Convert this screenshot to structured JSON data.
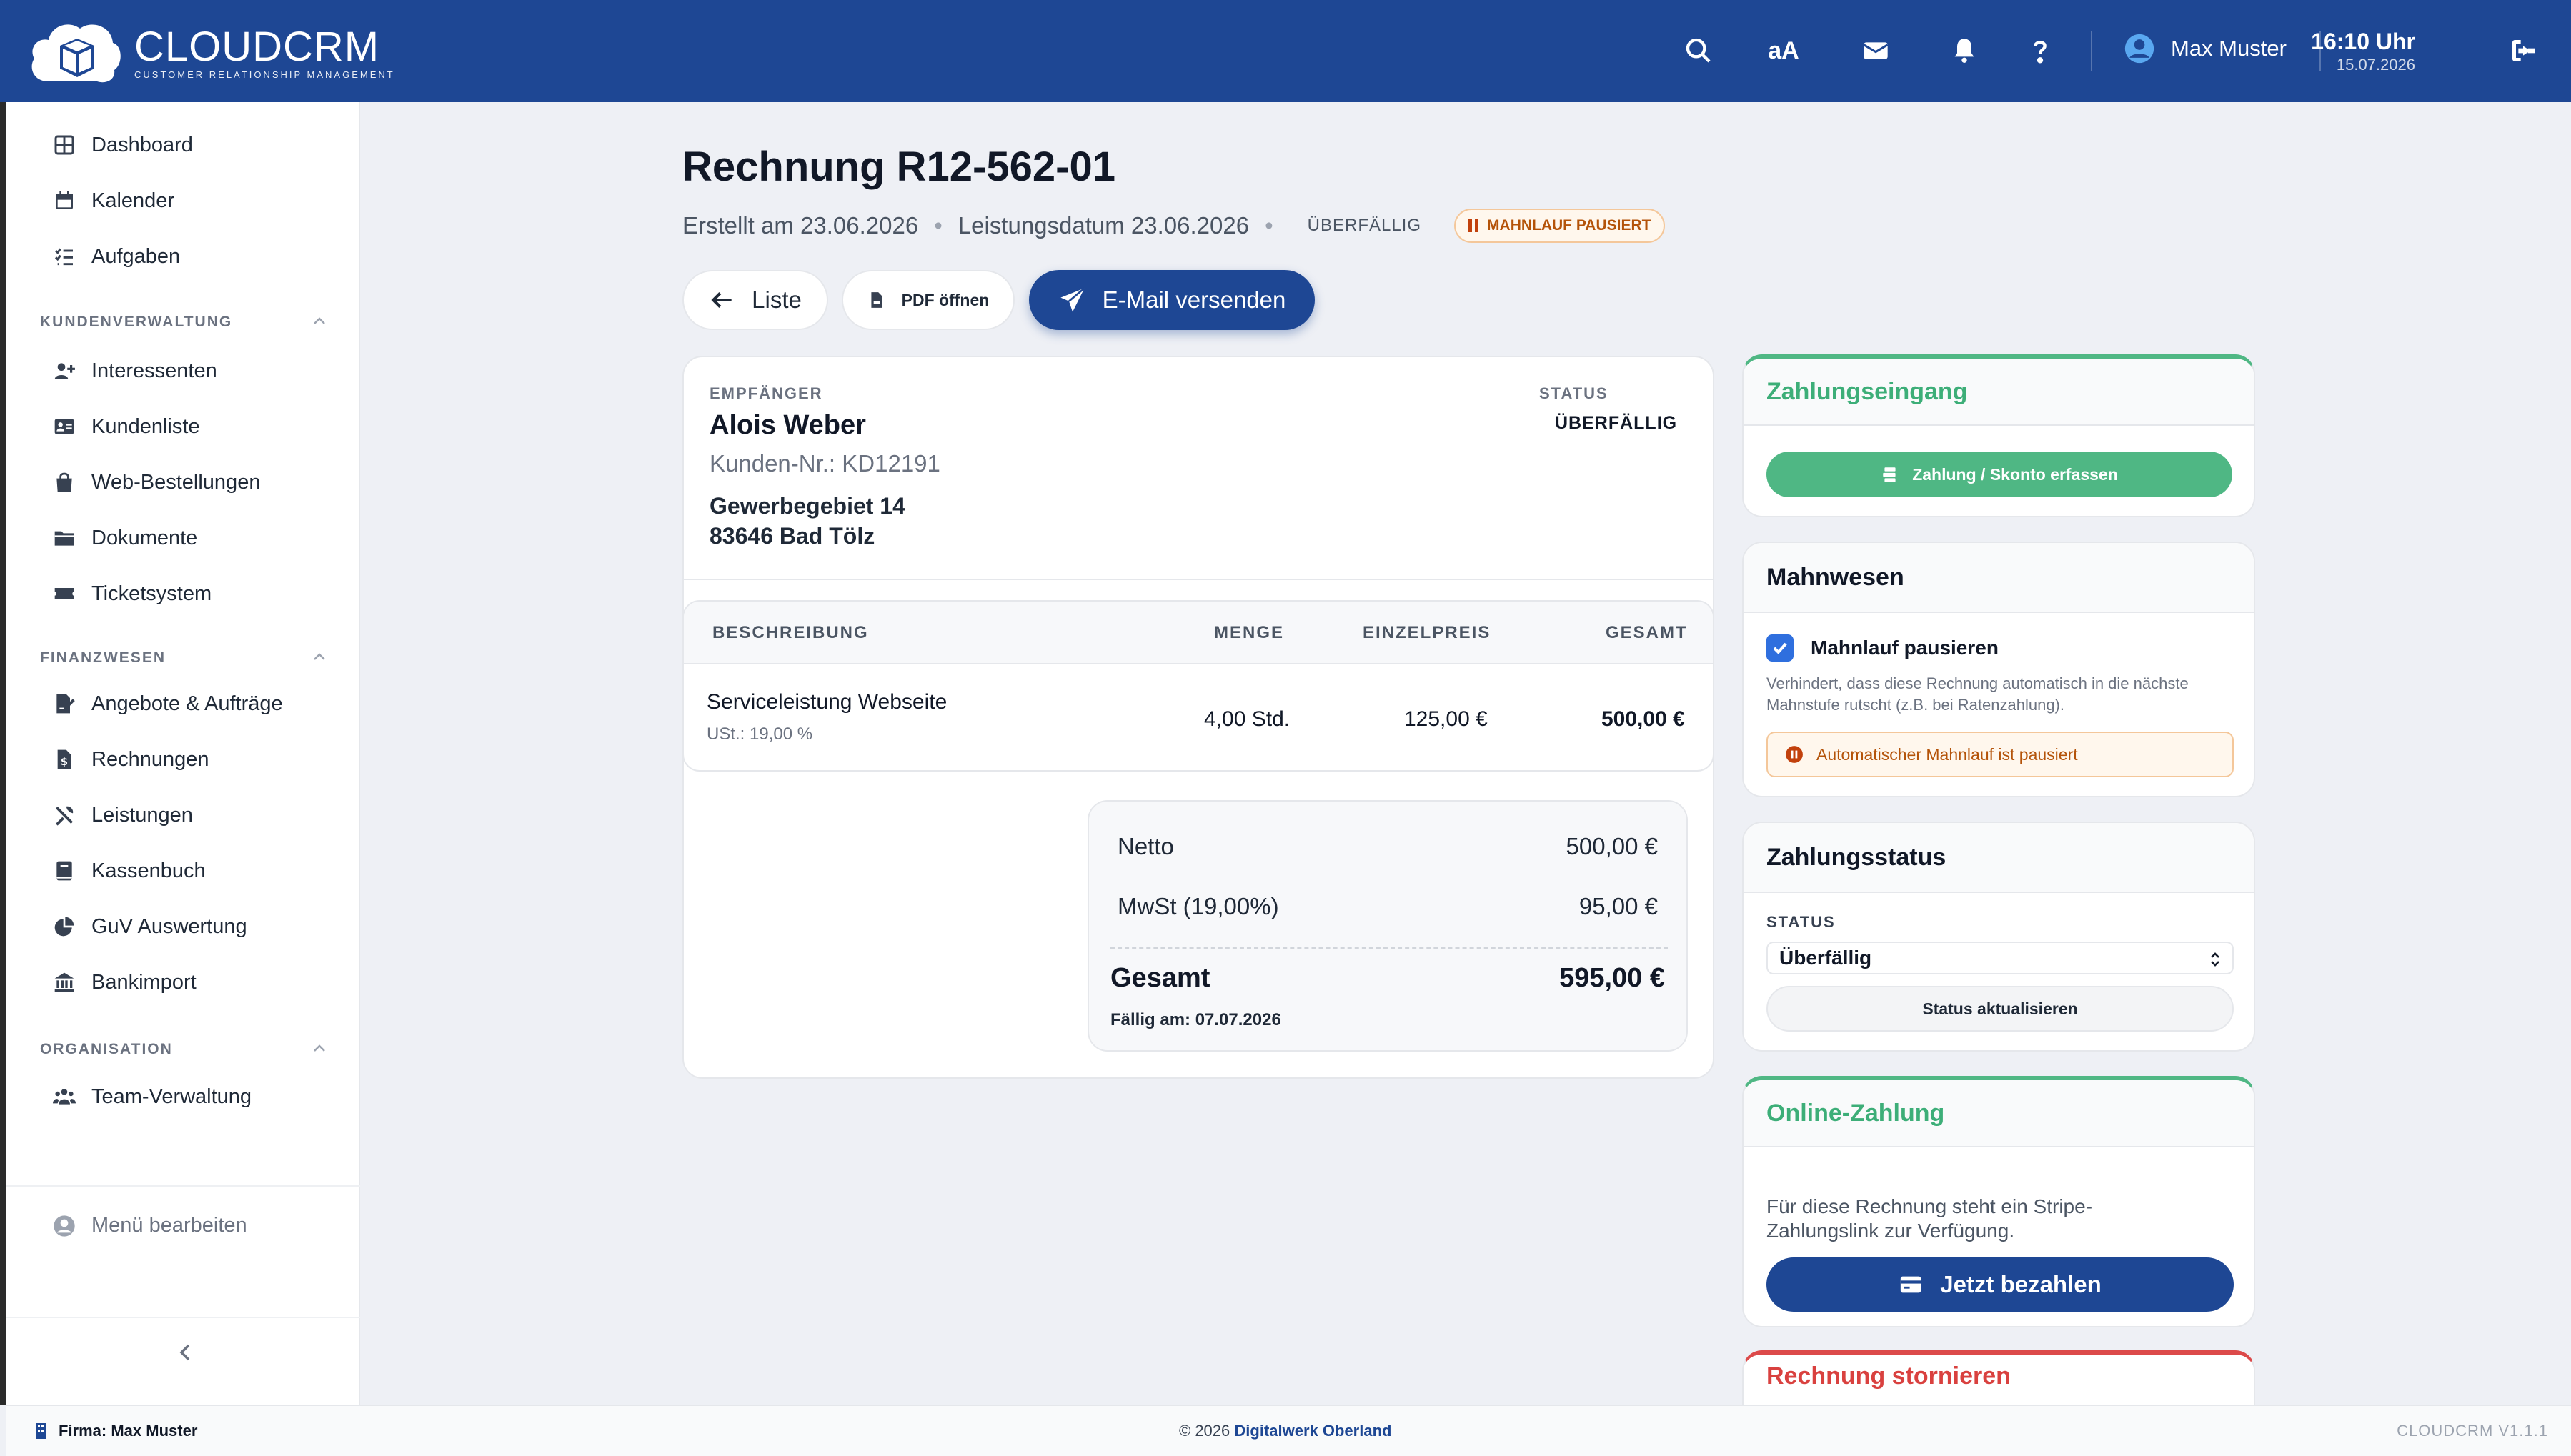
{
  "app": {
    "logo_title": "CLOUDCRM",
    "logo_subtitle": "CUSTOMER RELATIONSHIP MANAGEMENT"
  },
  "header": {
    "font_size_label": "aA",
    "user_name": "Max Muster",
    "time": "16:10 Uhr",
    "date": "15.07.2026",
    "icons": [
      "search-icon",
      "font-size-icon",
      "mail-icon",
      "bell-icon",
      "help-icon",
      "user-circle-icon",
      "logout-icon"
    ]
  },
  "sidebar": {
    "top_items": [
      {
        "label": "Dashboard",
        "icon": "dashboard-icon"
      },
      {
        "label": "Kalender",
        "icon": "calendar-icon"
      },
      {
        "label": "Aufgaben",
        "icon": "tasks-icon"
      }
    ],
    "sections": [
      {
        "title": "KUNDENVERWALTUNG",
        "items": [
          {
            "label": "Interessenten",
            "icon": "user-plus-icon"
          },
          {
            "label": "Kundenliste",
            "icon": "address-card-icon"
          },
          {
            "label": "Web-Bestellungen",
            "icon": "shopping-bag-icon"
          },
          {
            "label": "Dokumente",
            "icon": "folder-icon"
          },
          {
            "label": "Ticketsystem",
            "icon": "ticket-icon"
          }
        ]
      },
      {
        "title": "FINANZWESEN",
        "items": [
          {
            "label": "Angebote & Aufträge",
            "icon": "file-signature-icon"
          },
          {
            "label": "Rechnungen",
            "icon": "invoice-icon"
          },
          {
            "label": "Leistungen",
            "icon": "tools-icon"
          },
          {
            "label": "Kassenbuch",
            "icon": "book-icon"
          },
          {
            "label": "GuV Auswertung",
            "icon": "pie-chart-icon"
          },
          {
            "label": "Bankimport",
            "icon": "bank-icon"
          }
        ]
      },
      {
        "title": "ORGANISATION",
        "items": [
          {
            "label": "Team-Verwaltung",
            "icon": "users-icon"
          }
        ]
      }
    ],
    "menu_edit": "Menü bearbeiten"
  },
  "invoice": {
    "title": "Rechnung R12-562-01",
    "created": "Erstellt am 23.06.2026",
    "service_date": "Leistungsdatum 23.06.2026",
    "status_text": "ÜBERFÄLLIG",
    "dunning_badge": "MAHNLAUF PAUSIERT",
    "buttons": {
      "list": "Liste",
      "pdf": "PDF öffnen",
      "email": "E-Mail versenden"
    },
    "recipient": {
      "label": "EMPFÄNGER",
      "name": "Alois Weber",
      "customer_no": "Kunden-Nr.: KD12191",
      "street": "Gewerbegebiet 14",
      "city": "83646 Bad Tölz"
    },
    "status": {
      "label": "STATUS",
      "value": "ÜBERFÄLLIG"
    },
    "table": {
      "headers": [
        "BESCHREIBUNG",
        "MENGE",
        "EINZELPREIS",
        "GESAMT"
      ],
      "rows": [
        {
          "description": "Serviceleistung Webseite",
          "tax": "USt.: 19,00 %",
          "qty": "4,00 Std.",
          "unit_price": "125,00 €",
          "total": "500,00 €"
        }
      ]
    },
    "totals": {
      "net_label": "Netto",
      "net_value": "500,00 €",
      "vat_label": "MwSt (19,00%)",
      "vat_value": "95,00 €",
      "gross_label": "Gesamt",
      "gross_value": "595,00 €",
      "due": "Fällig am: 07.07.2026"
    }
  },
  "payment_in": {
    "title": "Zahlungseingang",
    "button": "Zahlung / Skonto erfassen"
  },
  "dunning": {
    "title": "Mahnwesen",
    "checkbox_label": "Mahnlauf pausieren",
    "checked": true,
    "description": "Verhindert, dass diese Rechnung automatisch in die nächste Mahnstufe rutscht (z.B. bei Ratenzahlung).",
    "alert": "Automatischer Mahnlauf ist pausiert"
  },
  "payment_status": {
    "title": "Zahlungsstatus",
    "label": "STATUS",
    "selected": "Überfällig",
    "button": "Status aktualisieren"
  },
  "online_payment": {
    "title": "Online-Zahlung",
    "text": "Für diese Rechnung steht ein Stripe-Zahlungslink zur Verfügung.",
    "button": "Jetzt bezahlen"
  },
  "cancel": {
    "title": "Rechnung stornieren"
  },
  "footer": {
    "company": "Firma: Max Muster",
    "copyright": "© 2026",
    "copyright_link": "Digitalwerk Oberland",
    "version": "CLOUDCRM V1.1.1"
  },
  "colors": {
    "primary": "#1e4794",
    "success": "#4fb784",
    "danger": "#dc4a4a",
    "warning_bg": "#fff7ed",
    "warning_text": "#b45309"
  }
}
